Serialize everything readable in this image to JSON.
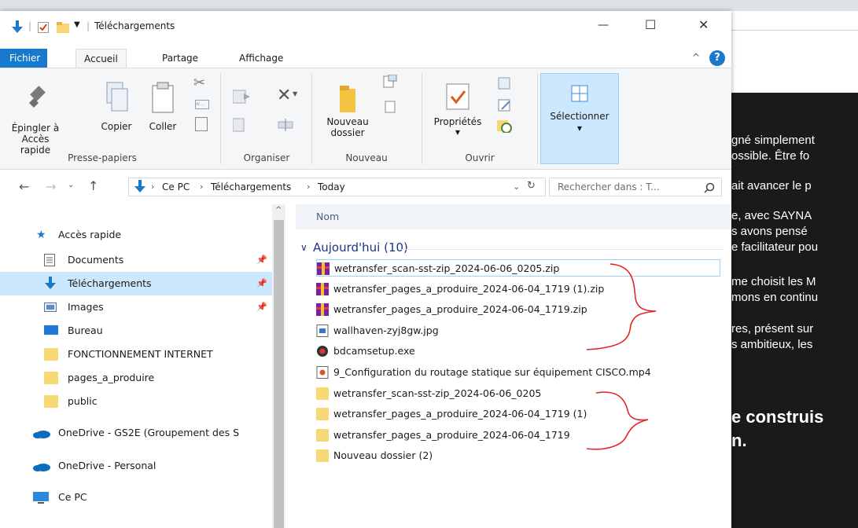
{
  "window": {
    "title": "Téléchargements",
    "controls": {
      "minimize": "—",
      "maximize": "☐",
      "close": "✕"
    }
  },
  "menu": {
    "tabs": [
      {
        "label": "Fichier"
      },
      {
        "label": "Accueil"
      },
      {
        "label": "Partage"
      },
      {
        "label": "Affichage"
      }
    ],
    "help": "?"
  },
  "ribbon": {
    "pin": {
      "line1": "Épingler à",
      "line2": "Accès rapide"
    },
    "copy": "Copier",
    "paste": "Coller",
    "group_clipboard": "Presse-papiers",
    "group_organize": "Organiser",
    "new_folder": {
      "line1": "Nouveau",
      "line2": "dossier"
    },
    "group_new": "Nouveau",
    "properties": "Propriétés",
    "group_open": "Ouvrir",
    "select": "Sélectionner"
  },
  "address": {
    "crumbs": [
      "Ce PC",
      "Téléchargements",
      "Today"
    ],
    "search_placeholder": "Rechercher dans : T..."
  },
  "nav": {
    "quick_access": "Accès rapide",
    "items": [
      {
        "label": "Documents"
      },
      {
        "label": "Téléchargements"
      },
      {
        "label": "Images"
      },
      {
        "label": "Bureau"
      },
      {
        "label": "FONCTIONNEMENT INTERNET"
      },
      {
        "label": "pages_a_produire"
      },
      {
        "label": "public"
      }
    ],
    "onedrive_org": "OneDrive - GS2E (Groupement des S",
    "onedrive_personal": "OneDrive - Personal",
    "this_pc": "Ce PC"
  },
  "content": {
    "column_name": "Nom",
    "group": "Aujourd'hui (10)",
    "files": [
      {
        "name": "wetransfer_scan-sst-zip_2024-06-06_0205.zip",
        "icon": "archive-icon"
      },
      {
        "name": "wetransfer_pages_a_produire_2024-06-04_1719 (1).zip",
        "icon": "archive-icon"
      },
      {
        "name": "wetransfer_pages_a_produire_2024-06-04_1719.zip",
        "icon": "archive-icon"
      },
      {
        "name": "wallhaven-zyj8gw.jpg",
        "icon": "image-file-icon"
      },
      {
        "name": "bdcamsetup.exe",
        "icon": "installer-icon"
      },
      {
        "name": "9_Configuration du routage statique sur équipement CISCO.mp4",
        "icon": "video-file-icon"
      },
      {
        "name": "wetransfer_scan-sst-zip_2024-06-06_0205",
        "icon": "folder-icon"
      },
      {
        "name": "wetransfer_pages_a_produire_2024-06-04_1719 (1)",
        "icon": "folder-icon"
      },
      {
        "name": "wetransfer_pages_a_produire_2024-06-04_1719",
        "icon": "folder-icon"
      },
      {
        "name": "Nouveau dossier (2)",
        "icon": "folder-icon"
      }
    ]
  },
  "background_page": {
    "lines": [
      "gné simplement",
      "ossible. Être fo",
      "ait avancer le p",
      "e, avec SAYNA",
      "s avons pensé",
      "e facilitateur pou",
      "me choisit les M",
      "mons en continu",
      "res, présent sur",
      "s ambitieux, les",
      "e construis",
      "n."
    ]
  },
  "colors": {
    "accent": "#1979ca",
    "selection": "#cce8ff",
    "annotation": "#e0262a"
  }
}
